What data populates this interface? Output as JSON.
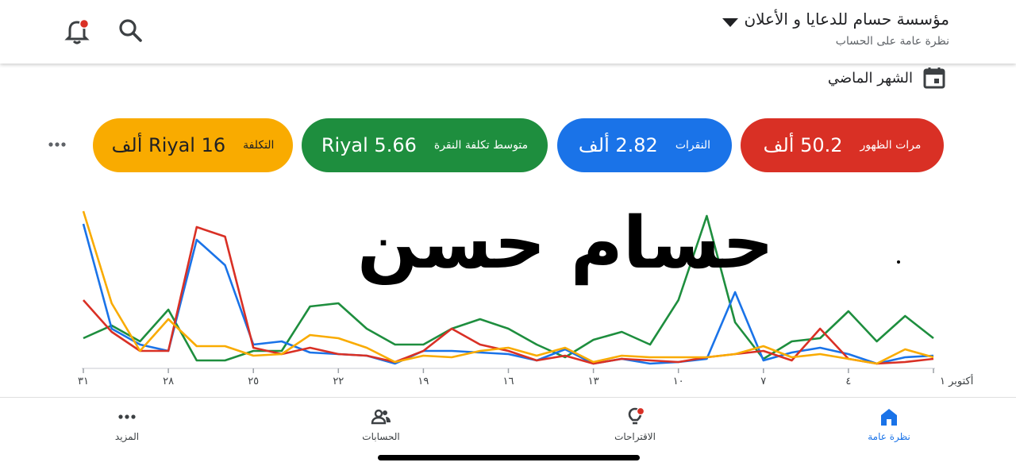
{
  "header": {
    "account_name": "مؤسسة حسام للدعايا و الأعلان",
    "subtitle": "نظرة عامة على الحساب"
  },
  "icons": {
    "search": "search-icon",
    "notifications": "bell-icon",
    "dropdown": "caret-down-icon",
    "calendar": "calendar-icon"
  },
  "date_range": {
    "label": "الشهر الماضي"
  },
  "metrics": {
    "impressions": {
      "name": "مرات الظهور",
      "value": "50.2 ألف",
      "color": "#d93025"
    },
    "clicks": {
      "name": "النقرات",
      "value": "2.82 ألف",
      "color": "#1a73e8"
    },
    "avg_cpc": {
      "name": "متوسط تكلفة النقرة",
      "value": "Riyal 5.66",
      "color": "#1e8e3e"
    },
    "cost": {
      "name": "التكلفة",
      "value": "Riyal 16 ألف",
      "color": "#f9ab00"
    }
  },
  "watermark_text": "حسام حسن",
  "chart_data": {
    "type": "line",
    "x_tick_labels": [
      "أكتوبر ١",
      "٤",
      "٧",
      "١٠",
      "١٣",
      "١٦",
      "١٩",
      "٢٢",
      "٢٥",
      "٢٨",
      "٣١"
    ],
    "x_direction": "right-to-left",
    "x": [
      1,
      2,
      3,
      4,
      5,
      6,
      7,
      8,
      9,
      10,
      11,
      12,
      13,
      14,
      15,
      16,
      17,
      18,
      19,
      20,
      21,
      22,
      23,
      24,
      25,
      26,
      27,
      28,
      29,
      30,
      31
    ],
    "ylim": [
      0,
      100
    ],
    "grid": false,
    "series": [
      {
        "color": "#1e8e3e",
        "values": [
          18,
          32,
          16,
          35,
          18,
          16,
          5,
          28,
          95,
          42,
          14,
          22,
          17,
          6,
          14,
          24,
          30,
          24,
          14,
          14,
          24,
          40,
          38,
          10,
          10,
          4,
          4,
          36,
          16,
          26,
          18
        ]
      },
      {
        "color": "#1a73e8",
        "values": [
          7,
          6,
          2,
          8,
          12,
          9,
          4,
          47,
          5,
          3,
          2,
          5,
          2,
          11,
          4,
          8,
          9,
          10,
          10,
          2,
          7,
          8,
          9,
          16,
          14,
          64,
          80,
          10,
          14,
          24,
          90
        ]
      },
      {
        "color": "#d93025",
        "values": [
          5,
          3,
          2,
          5,
          24,
          4,
          10,
          8,
          6,
          3,
          4,
          5,
          2,
          7,
          4,
          10,
          14,
          24,
          10,
          3,
          7,
          8,
          12,
          8,
          12,
          82,
          88,
          10,
          10,
          22,
          42
        ]
      },
      {
        "color": "#f9ab00",
        "values": [
          6,
          11,
          2,
          5,
          8,
          6,
          13,
          8,
          6,
          6,
          6,
          7,
          3,
          12,
          7,
          12,
          10,
          6,
          7,
          3,
          12,
          18,
          20,
          8,
          7,
          13,
          13,
          30,
          10,
          40,
          98
        ]
      }
    ]
  },
  "bottom_nav": {
    "overview": "نظرة عامة",
    "recommendations": "الاقتراحات",
    "accounts": "الحسابات",
    "more": "المزيد"
  }
}
